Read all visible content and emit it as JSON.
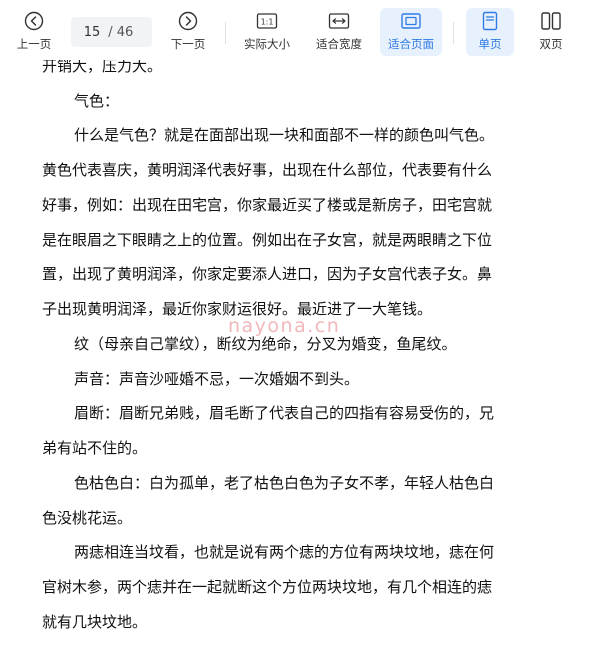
{
  "toolbar": {
    "prev_label": "上一页",
    "page_current": "15",
    "page_total": "/ 46",
    "next_label": "下一页",
    "actual_size_label": "实际大小",
    "fit_width_label": "适合宽度",
    "fit_page_label": "适合页面",
    "single_page_label": "单页",
    "double_page_label": "双页",
    "actual_size_glyph": "1:1",
    "accent_color": "#2f7ae5",
    "active_bg": "#e7f1fd"
  },
  "document": {
    "lines": [
      "开销大，压力大。",
      "气色：",
      "什么是气色？就是在面部出现一块和面部不一样的颜色叫气色。",
      "黄色代表喜庆，黄明润泽代表好事，出现在什么部位，代表要有什么",
      "好事，例如：出现在田宅宫，你家最近买了楼或是新房子，田宅宫就",
      "是在眼眉之下眼睛之上的位置。例如出在子女宫，就是两眼睛之下位",
      "置，出现了黄明润泽，你家定要添人进口，因为子女宫代表子女。鼻",
      "子出现黄明润泽，最近你家财运很好。最近进了一大笔钱。",
      "纹（母亲自己掌纹），断纹为绝命，分叉为婚变，鱼尾纹。",
      "声音：声音沙哑婚不忌，一次婚姻不到头。",
      "眉断：眉断兄弟贱，眉毛断了代表自己的四指有容易受伤的，兄",
      "弟有站不住的。",
      "色枯色白：白为孤单，老了枯色白色为子女不孝，年轻人枯色白",
      "色没桃花运。",
      "两痣相连当坟看，也就是说有两个痣的方位有两块坟地，痣在何",
      "官树木参，两个痣并在一起就断这个方位两块坟地，有几个相连的痣",
      "就有几块坟地。"
    ],
    "watermark": "nayona.cn"
  }
}
